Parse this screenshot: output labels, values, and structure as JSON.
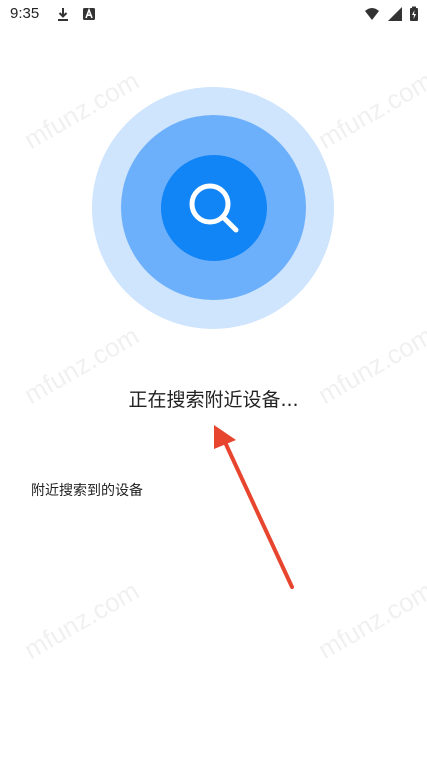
{
  "status_bar": {
    "time": "9:35",
    "left_icons": [
      "download-icon",
      "a-badge-icon"
    ],
    "right_icons": [
      "wifi-icon",
      "cellular-signal-icon",
      "battery-charging-icon"
    ]
  },
  "watermark": "mfunz.com",
  "radar": {
    "outer_color": "#cfe4fd",
    "mid_color": "#6cb0fb",
    "inner_color": "#1184f6",
    "center_icon": "search-icon"
  },
  "status_text": "正在搜索附近设备...",
  "devices_section_label": "附近搜索到的设备",
  "annotation": {
    "type": "arrow",
    "color": "#e8452f"
  }
}
